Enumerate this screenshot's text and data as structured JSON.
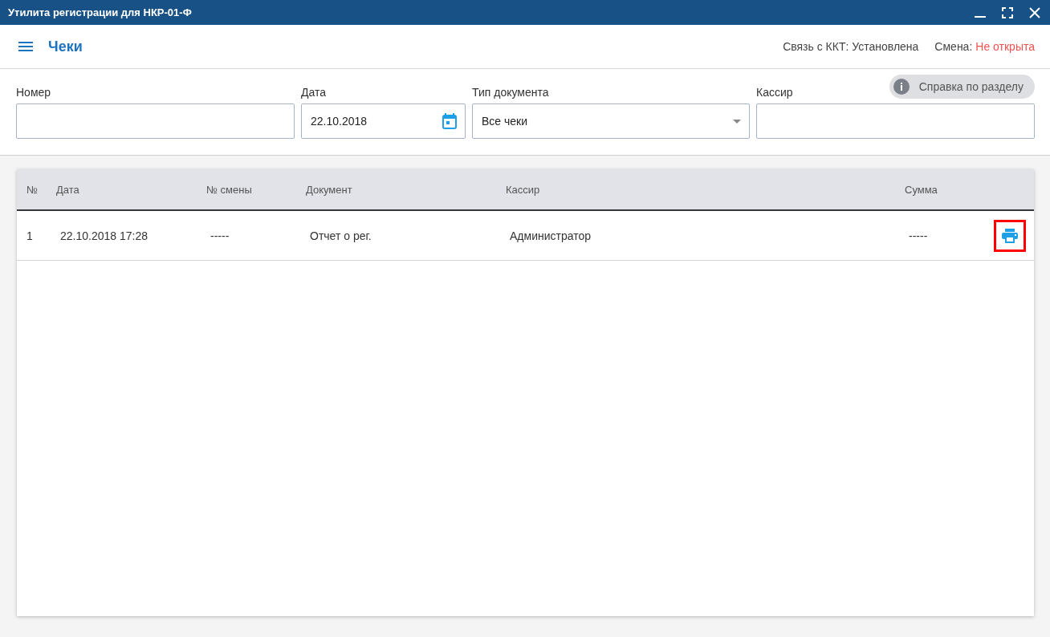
{
  "window": {
    "title": "Утилита регистрации для НКР-01-Ф"
  },
  "header": {
    "title": "Чеки",
    "connection": "Связь с ККТ: Установлена",
    "shift_label": "Смена:",
    "shift_value": "Не открыта",
    "shift_open": false
  },
  "help_button": {
    "label": "Справка по разделу"
  },
  "filters": [
    {
      "kind": "text",
      "label": "Номер"
    },
    {
      "kind": "date",
      "label": "Дата",
      "value": "22.10.2018"
    },
    {
      "kind": "select",
      "label": "Тип документа",
      "value": "Все чеки"
    },
    {
      "kind": "text",
      "label": "Кассир"
    }
  ],
  "table": {
    "columns": [
      "№",
      "Дата",
      "№ смены",
      "Документ",
      "Кассир",
      "Сумма"
    ],
    "rows": [
      {
        "cells": [
          "1",
          "22.10.2018 17:28",
          "-----",
          "Отчет о рег.",
          "Администратор",
          "-----"
        ],
        "print_highlighted": true
      }
    ]
  }
}
